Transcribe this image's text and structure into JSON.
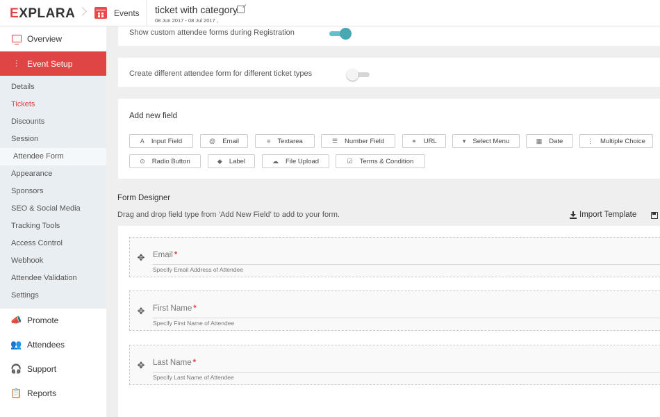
{
  "app": {
    "brand_first": "E",
    "brand_rest": "XPLARA"
  },
  "breadcrumb": {
    "events_label": "Events"
  },
  "event": {
    "title": "ticket with category",
    "dates": "08 Jun 2017 - 08 Jul 2017 ,"
  },
  "sidebar": {
    "overview": "Overview",
    "event_setup": "Event Setup",
    "sub": [
      "Details",
      "Tickets",
      "Discounts",
      "Session",
      "Attendee Form",
      "Appearance",
      "Sponsors",
      "SEO & Social Media",
      "Tracking Tools",
      "Access Control",
      "Webhook",
      "Attendee Validation",
      "Settings"
    ],
    "promote": "Promote",
    "attendees": "Attendees",
    "support": "Support",
    "reports": "Reports"
  },
  "settings": {
    "custom_forms_label": "Show custom attendee forms during Registration",
    "custom_forms_on": true,
    "diff_forms_label": "Create different attendee form for different ticket types",
    "diff_forms_on": false
  },
  "add_new_field": {
    "title": "Add new field",
    "buttons": [
      {
        "glyph": "A",
        "label": "Input Field"
      },
      {
        "glyph": "@",
        "label": "Email"
      },
      {
        "glyph": "≡",
        "label": "Textarea"
      },
      {
        "glyph": "☰",
        "label": "Number Field"
      },
      {
        "glyph": "⚭",
        "label": "URL"
      },
      {
        "glyph": "▾",
        "label": "Select Menu"
      },
      {
        "glyph": "▦",
        "label": "Date"
      },
      {
        "glyph": "⋮",
        "label": "Multiple Choice"
      },
      {
        "glyph": "⊙",
        "label": "Radio Button"
      },
      {
        "glyph": "◆",
        "label": "Label"
      },
      {
        "glyph": "☁",
        "label": "File Upload"
      },
      {
        "glyph": "☑",
        "label": "Terms & Condition"
      }
    ]
  },
  "form_designer": {
    "title": "Form Designer",
    "subtitle": "Drag and drop field type from ‘Add New Field’ to add to your form.",
    "import_label": "Import Template",
    "fields": [
      {
        "label": "Email",
        "required_mark": "*",
        "hint": "Specify Email Address of Attendee"
      },
      {
        "label": "First Name",
        "required_mark": "*",
        "hint": "Specify First Name of Attendee"
      },
      {
        "label": "Last Name",
        "required_mark": "*",
        "hint": "Specify Last Name of Attendee"
      }
    ]
  },
  "colors": {
    "accent": "#e04545",
    "toggle_on": "#4aa8b3",
    "submenu_bg": "#e9eef2"
  }
}
